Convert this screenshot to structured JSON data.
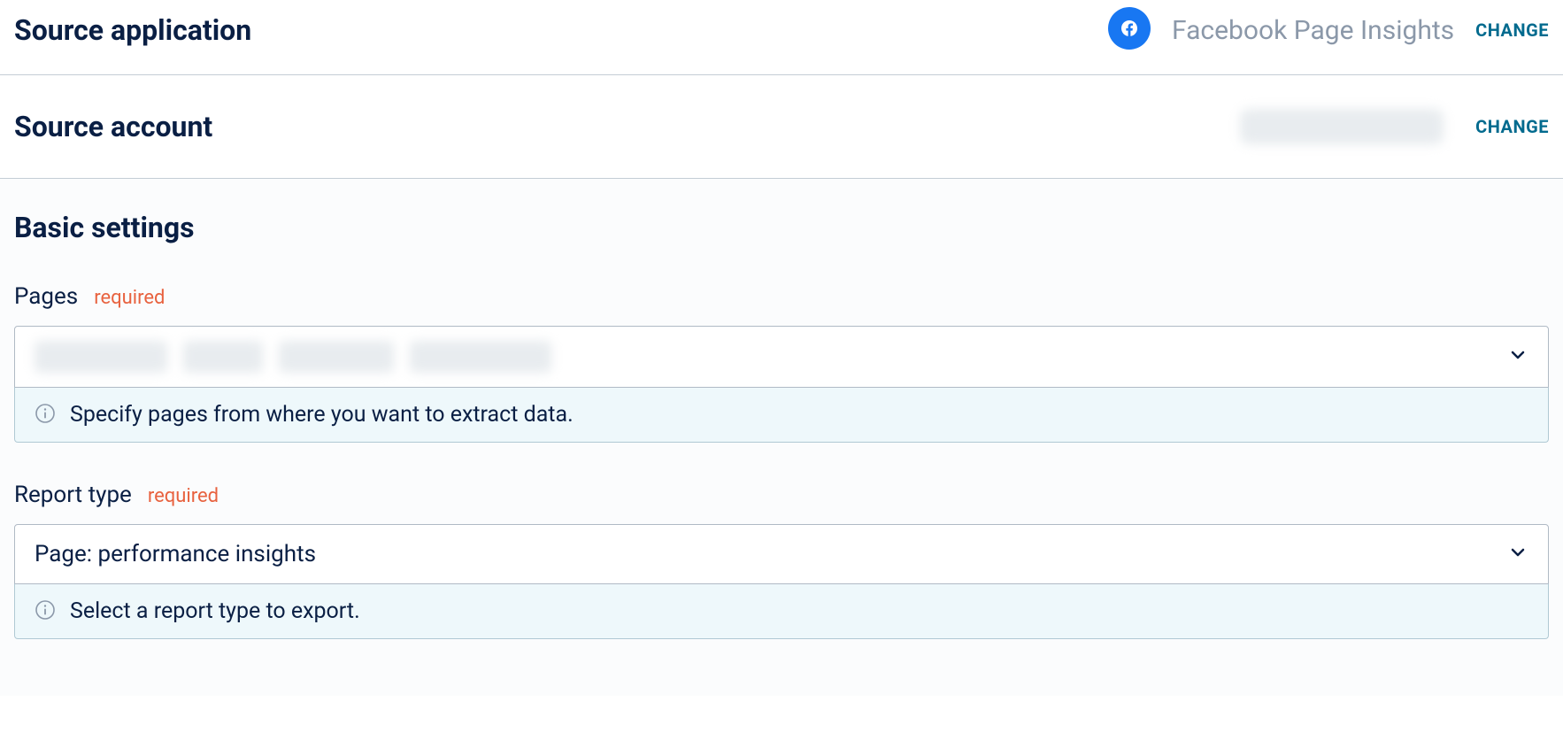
{
  "sourceApplication": {
    "title": "Source application",
    "appName": "Facebook Page Insights",
    "changeLabel": "CHANGE"
  },
  "sourceAccount": {
    "title": "Source account",
    "changeLabel": "CHANGE"
  },
  "basicSettings": {
    "title": "Basic settings",
    "pages": {
      "label": "Pages",
      "requiredLabel": "required",
      "hint": "Specify pages from where you want to extract data."
    },
    "reportType": {
      "label": "Report type",
      "requiredLabel": "required",
      "value": "Page: performance insights",
      "hint": "Select a report type to export."
    }
  }
}
